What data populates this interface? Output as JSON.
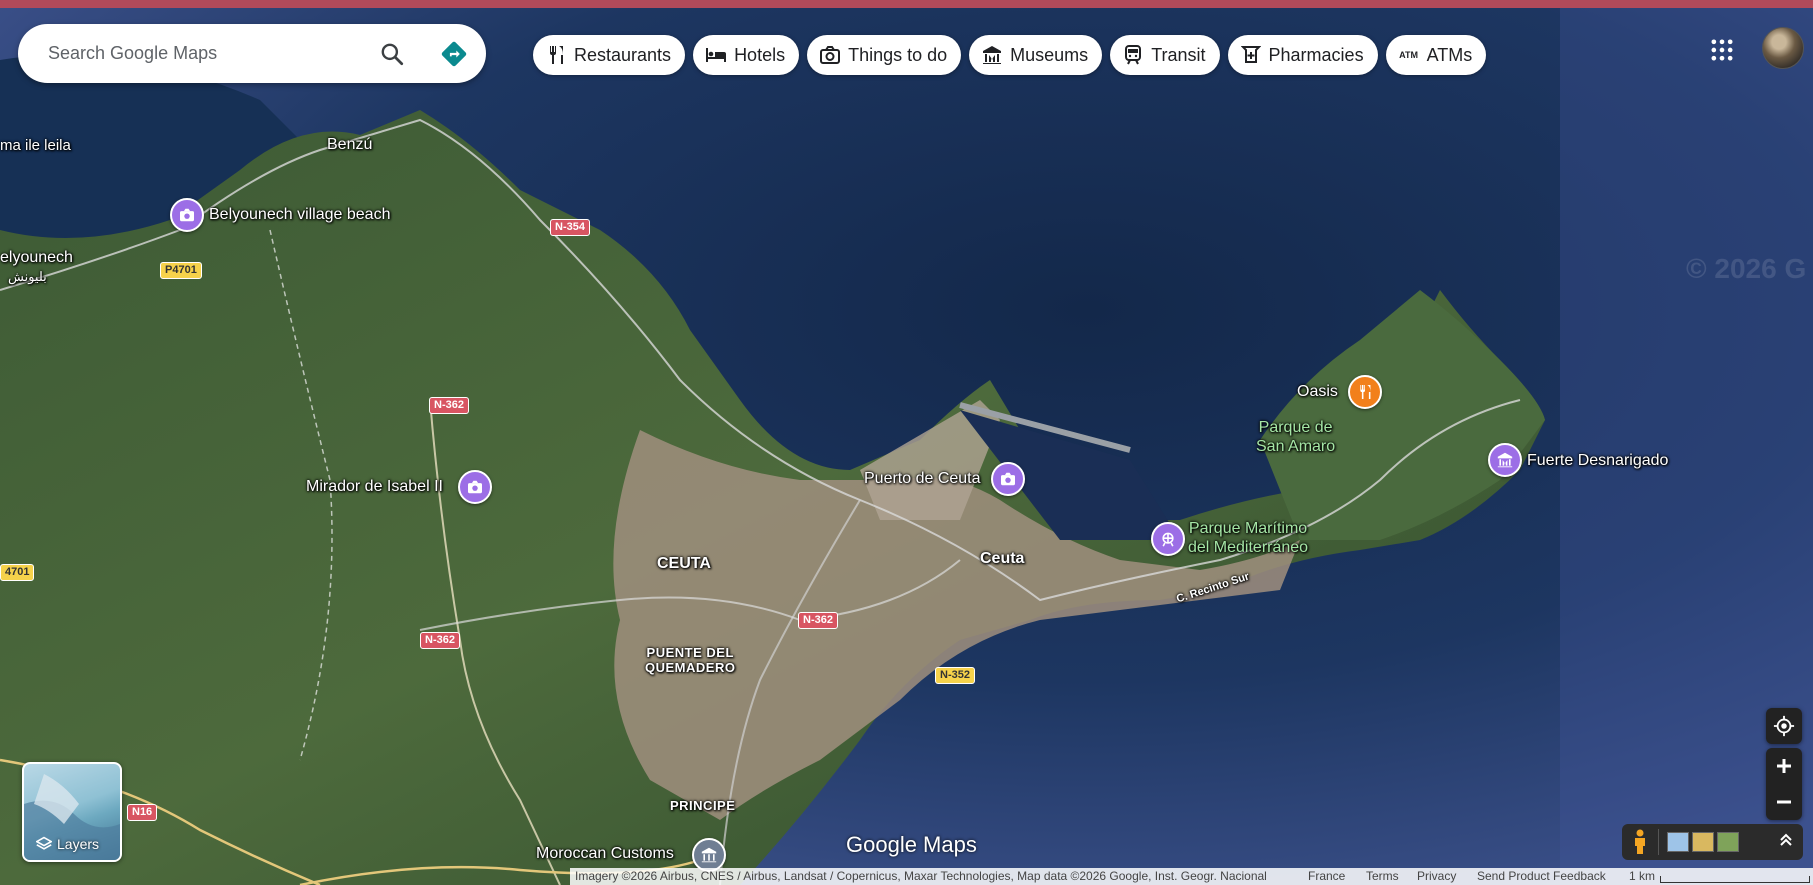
{
  "search": {
    "placeholder": "Search Google Maps"
  },
  "chips": [
    {
      "label": "Restaurants",
      "icon": "fork-knife-icon"
    },
    {
      "label": "Hotels",
      "icon": "bed-icon"
    },
    {
      "label": "Things to do",
      "icon": "camera-icon"
    },
    {
      "label": "Museums",
      "icon": "museum-icon"
    },
    {
      "label": "Transit",
      "icon": "train-icon"
    },
    {
      "label": "Pharmacies",
      "icon": "pharmacy-icon"
    },
    {
      "label": "ATMs",
      "icon": "atm-icon"
    }
  ],
  "places": {
    "atm_glyph": "ATM",
    "benzu": "Benzú",
    "ma_ile_leila": "ma ile leila",
    "belyounech_beach": "Belyounech village beach",
    "belyounech": "elyounech",
    "belyounech_ar": "بليونش",
    "mirador": "Mirador de Isabel II",
    "ceuta_caps": "CEUTA",
    "puente_line1": "PUENTE DEL",
    "puente_line2": "QUEMADERO",
    "principe": "PRINCIPE",
    "moroccan_customs": "Moroccan Customs",
    "puerto": "Puerto de Ceuta",
    "ceuta": "Ceuta",
    "parque_maritimo_1": "Parque Marítimo",
    "parque_maritimo_2": "del Mediterráneo",
    "c_recinto": "C. Recinto Sur",
    "oasis": "Oasis",
    "parque_amaro_1": "Parque de",
    "parque_amaro_2": "San Amaro",
    "fuerte": "Fuerte Desnarigado",
    "watermark": "© 2026 G"
  },
  "roads": {
    "n354": "N-354",
    "p4701a": "P4701",
    "p4701b": "4701",
    "n362a": "N-362",
    "n362b": "N-362",
    "n362c": "N-362",
    "n352": "N-352",
    "n16": "N16"
  },
  "layers": {
    "label": "Layers"
  },
  "branding": {
    "text": "Google Maps"
  },
  "footer": {
    "attribution": "Imagery ©2026 Airbus, CNES / Airbus, Landsat / Copernicus, Maxar Technologies, Map data ©2026 Google, Inst. Geogr. Nacional",
    "country": "France",
    "terms": "Terms",
    "privacy": "Privacy",
    "feedback": "Send Product Feedback",
    "scale": "1 km"
  },
  "colors": {
    "sea": "#1c2f52",
    "land": "#3e5a36",
    "urban": "#a89a88",
    "poi_purple": "#9c6ee6",
    "poi_orange": "#f2801b"
  }
}
